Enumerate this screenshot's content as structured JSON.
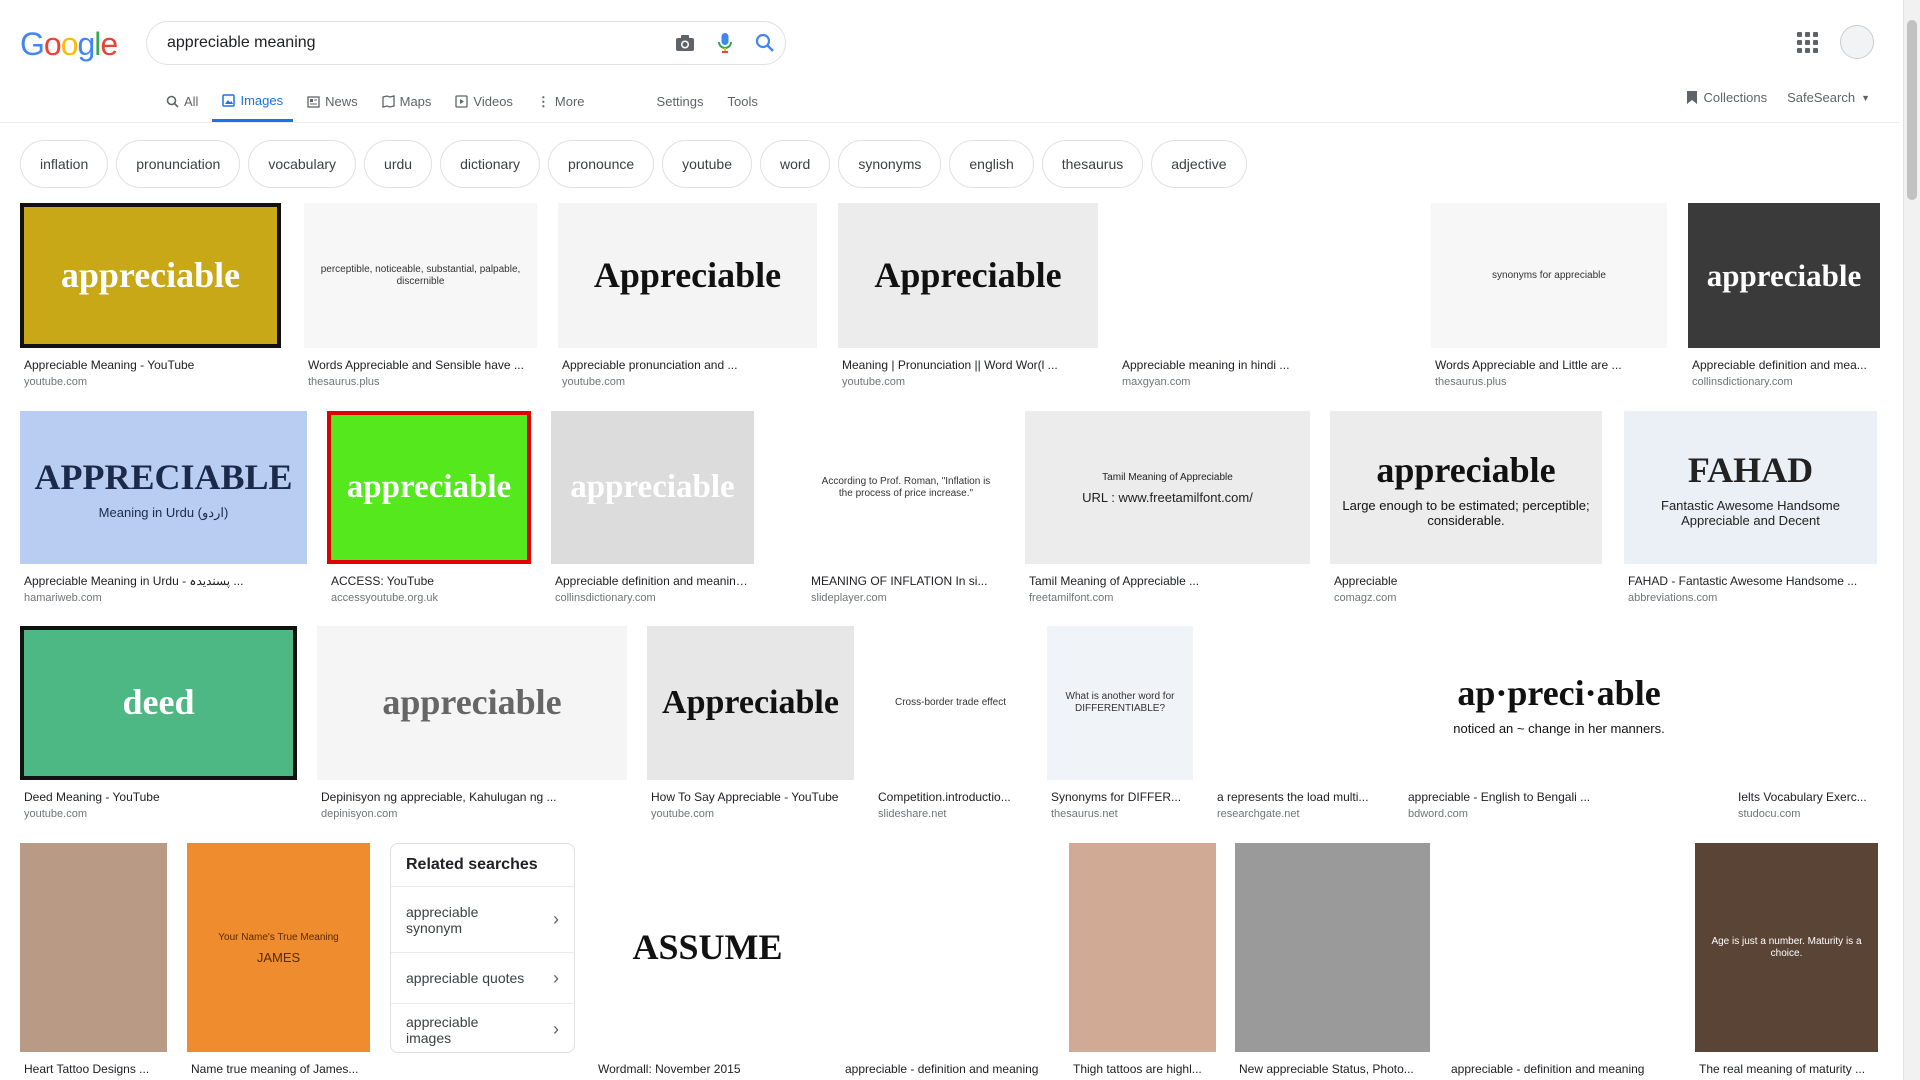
{
  "logo": [
    "G",
    "o",
    "o",
    "g",
    "l",
    "e"
  ],
  "search": {
    "query": "appreciable meaning"
  },
  "tabs": [
    {
      "label": "All",
      "icon": "search-icon"
    },
    {
      "label": "Images",
      "icon": "image-icon",
      "active": true
    },
    {
      "label": "News",
      "icon": "news-icon"
    },
    {
      "label": "Maps",
      "icon": "map-icon"
    },
    {
      "label": "Videos",
      "icon": "video-icon"
    },
    {
      "label": "More",
      "icon": "more-icon"
    },
    {
      "label": "Settings"
    },
    {
      "label": "Tools"
    }
  ],
  "right_tools": {
    "collections": "Collections",
    "safesearch": "SafeSearch"
  },
  "chips": [
    "inflation",
    "pronunciation",
    "vocabulary",
    "urdu",
    "dictionary",
    "pronounce",
    "youtube",
    "word",
    "synonyms",
    "english",
    "thesaurus",
    "adjective"
  ],
  "rows": [
    [
      {
        "caption": "Appreciable Meaning - YouTube",
        "source": "youtube.com",
        "overlay": "appreciable",
        "bg": "#c8a816",
        "fg": "#ffffff",
        "border": "#111"
      },
      {
        "caption": "Words Appreciable and Sensible have ...",
        "source": "thesaurus.plus",
        "overlay": "perceptible, noticeable, substantial, palpable, discernible",
        "bg": "#f7f7f7",
        "fg": "#333"
      },
      {
        "caption": "Appreciable pronunciation and ...",
        "source": "youtube.com",
        "overlay": "Appreciable",
        "bg": "#f4f4f4",
        "fg": "#111"
      },
      {
        "caption": "Meaning | Pronunciation || Word Wor(l ...",
        "source": "youtube.com",
        "overlay": "Appreciable",
        "bg": "#ececec",
        "fg": "#111"
      },
      {
        "caption": "Appreciable meaning in hindi ...",
        "source": "maxgyan.com",
        "overlay": "",
        "bg": "#ffffff",
        "fg": "#333"
      },
      {
        "caption": "Words Appreciable and Little are ...",
        "source": "thesaurus.plus",
        "overlay": "synonyms for appreciable",
        "bg": "#f7f7f7",
        "fg": "#333"
      },
      {
        "caption": "Appreciable definition and mea...",
        "source": "collinsdictionary.com",
        "overlay": "appreciable",
        "bg": "#3a3a3a",
        "fg": "#ffffff"
      }
    ],
    [
      {
        "caption": "Appreciable Meaning in Urdu - پسندیدہ ...",
        "source": "hamariweb.com",
        "overlay": "APPRECIABLE",
        "overlay2": "Meaning in Urdu (اردو)",
        "bg": "#b9cdf2",
        "fg": "#1b2a4a"
      },
      {
        "caption": "ACCESS: YouTube",
        "source": "accessyoutube.org.uk",
        "overlay": "appreciable",
        "bg": "#55e81c",
        "fg": "#ffffff",
        "border": "#e00000"
      },
      {
        "caption": "Appreciable definition and meaning ...",
        "source": "collinsdictionary.com",
        "overlay": "appreciable",
        "bg": "#dcdcdc",
        "fg": "#ffffff"
      },
      {
        "caption": "MEANING OF INFLATION In si...",
        "source": "slideplayer.com",
        "overlay": "According to Prof. Roman, \"Inflation is the process of price increase.\"",
        "bg": "#ffffff",
        "fg": "#333"
      },
      {
        "caption": "Tamil Meaning of Appreciable ...",
        "source": "freetamilfont.com",
        "overlay": "Tamil Meaning of Appreciable",
        "overlay2": "URL : www.freetamilfont.com/",
        "bg": "#ececec",
        "fg": "#222"
      },
      {
        "caption": "Appreciable",
        "source": "comagz.com",
        "overlay": "appreciable",
        "overlay2": "Large enough to be estimated; perceptible; considerable.",
        "bg": "#ececec",
        "fg": "#111"
      },
      {
        "caption": "FAHAD - Fantastic Awesome Handsome ...",
        "source": "abbreviations.com",
        "overlay": "FAHAD",
        "overlay2": "Fantastic Awesome Handsome Appreciable and Decent",
        "bg": "#eaf0f5",
        "fg": "#222"
      }
    ],
    [
      {
        "caption": "Deed Meaning - YouTube",
        "source": "youtube.com",
        "overlay": "deed",
        "bg": "#4db883",
        "fg": "#ffffff",
        "border": "#111"
      },
      {
        "caption": "Depinisyon ng appreciable, Kahulugan ng ...",
        "source": "depinisyon.com",
        "overlay": "appreciable",
        "bg": "#f5f5f5",
        "fg": "#666"
      },
      {
        "caption": "How To Say Appreciable - YouTube",
        "source": "youtube.com",
        "overlay": "Appreciable",
        "bg": "#e7e7e7",
        "fg": "#111"
      },
      {
        "caption": "Competition.introductio...",
        "source": "slideshare.net",
        "overlay": "Cross-border trade effect",
        "bg": "#ffffff",
        "fg": "#333"
      },
      {
        "caption": "Synonyms for DIFFER...",
        "source": "thesaurus.net",
        "overlay": "What is another word for DIFFERENTIABLE?",
        "bg": "#f0f4f8",
        "fg": "#333"
      },
      {
        "caption": "a represents the load multi...",
        "source": "researchgate.net",
        "overlay": "",
        "bg": "#ffffff",
        "fg": "#333"
      },
      {
        "caption": "appreciable - English to Bengali ...",
        "source": "bdword.com",
        "overlay": "ap·preci·able",
        "overlay2": "noticed an ~ change in her manners.",
        "bg": "#ffffff",
        "fg": "#111"
      },
      {
        "caption": "Ielts Vocabulary Exerc...",
        "source": "studocu.com",
        "overlay": "",
        "bg": "#ffffff",
        "fg": "#333"
      }
    ],
    [
      {
        "caption": "Heart Tattoo Designs ...",
        "source": "",
        "overlay": "",
        "bg": "#b99a85",
        "fg": "#222"
      },
      {
        "caption": "Name true meaning of James...",
        "source": "",
        "overlay": "Your Name's True Meaning",
        "overlay2": "JAMES",
        "bg": "#ee8c2e",
        "fg": "#5a2a00"
      },
      {
        "caption": "Wordmall: November 2015",
        "source": "",
        "overlay": "ASSUME",
        "bg": "#ffffff",
        "fg": "#111"
      },
      {
        "caption": "appreciable - definition and meaning",
        "source": "",
        "overlay": "",
        "bg": "#ffffff",
        "fg": "#333"
      },
      {
        "caption": "Thigh tattoos are highl...",
        "source": "",
        "overlay": "",
        "bg": "#d0aa95",
        "fg": "#222"
      },
      {
        "caption": "New appreciable Status, Photo...",
        "source": "",
        "overlay": "",
        "bg": "#9a9a9a",
        "fg": "#fff"
      },
      {
        "caption": "appreciable - definition and meaning",
        "source": "",
        "overlay": "",
        "bg": "#ffffff",
        "fg": "#333"
      },
      {
        "caption": "The real meaning of maturity ...",
        "source": "",
        "overlay": "Age is just a number. Maturity is a choice.",
        "bg": "#5a4436",
        "fg": "#fff"
      }
    ]
  ],
  "related": {
    "title": "Related searches",
    "items": [
      "appreciable synonym",
      "appreciable quotes",
      "appreciable images"
    ]
  }
}
